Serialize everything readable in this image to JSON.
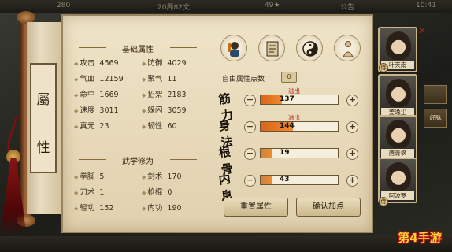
{
  "topbar": {
    "hud1": "280",
    "hud2": "20周82文",
    "hud3": "49★",
    "hud4": "公告",
    "hud5": "10:41"
  },
  "scroll": {
    "title_top": "屬",
    "title_bottom": "性"
  },
  "basic": {
    "title": "基础属性",
    "left": [
      {
        "label": "攻击",
        "value": "4569"
      },
      {
        "label": "气血",
        "value": "12159"
      },
      {
        "label": "命中",
        "value": "1669"
      },
      {
        "label": "速度",
        "value": "3011"
      },
      {
        "label": "真元",
        "value": "23"
      }
    ],
    "right": [
      {
        "label": "防御",
        "value": "4029"
      },
      {
        "label": "聚气",
        "value": "11"
      },
      {
        "label": "招架",
        "value": "2183"
      },
      {
        "label": "躲闪",
        "value": "3059"
      },
      {
        "label": "韧性",
        "value": "60"
      }
    ]
  },
  "martial": {
    "title": "武学修为",
    "left": [
      {
        "label": "拳脚",
        "value": "5"
      },
      {
        "label": "刀术",
        "value": "1"
      },
      {
        "label": "轻功",
        "value": "152"
      }
    ],
    "right": [
      {
        "label": "剑术",
        "value": "170"
      },
      {
        "label": "枪棍",
        "value": "0"
      },
      {
        "label": "内功",
        "value": "190"
      }
    ]
  },
  "tabs": [
    {
      "icon": "warrior-icon"
    },
    {
      "icon": "attribute-book-icon",
      "label": "属性"
    },
    {
      "icon": "taiji-icon"
    },
    {
      "icon": "meditate-icon"
    }
  ],
  "free_points": {
    "label": "自由属性点数",
    "value": "0"
  },
  "attributes": [
    {
      "name": "筋力",
      "value": "137",
      "overflow": "溢出",
      "fill": 0.28,
      "color": "#d9641a"
    },
    {
      "name": "身法",
      "value": "144",
      "overflow": "溢出",
      "fill": 0.42,
      "color": "#d9641a"
    },
    {
      "name": "根骨",
      "value": "19",
      "overflow": "",
      "fill": 0.14,
      "color": "#c88640"
    },
    {
      "name": "内息",
      "value": "43",
      "overflow": "",
      "fill": 0.14,
      "color": "#c88640"
    }
  ],
  "buttons": {
    "reset": "重置属性",
    "confirm": "确认加点"
  },
  "characters": [
    {
      "name": "叶天南",
      "badge": "侍"
    },
    {
      "name": "姜逸尘",
      "badge": ""
    },
    {
      "name": "唐青枫",
      "badge": ""
    },
    {
      "name": "阿波罗",
      "badge": "侍"
    }
  ],
  "side_tabs": [
    "",
    "经脉"
  ],
  "watermark": "第4手游",
  "colors": {
    "accent_red": "#b0241a",
    "bar_fill": "#d9641a",
    "parchment": "#e6d8b8"
  }
}
